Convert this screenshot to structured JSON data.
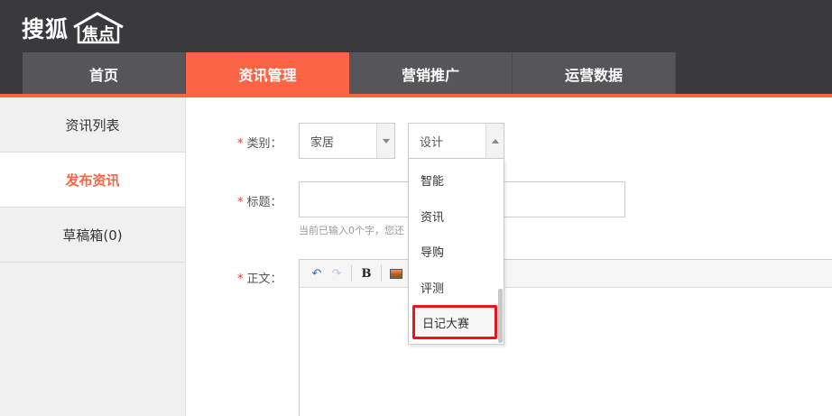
{
  "header": {
    "logo_text": "搜狐",
    "logo_house_text": "焦点"
  },
  "nav": {
    "tabs": [
      {
        "label": "首页",
        "active": false
      },
      {
        "label": "资讯管理",
        "active": true
      },
      {
        "label": "营销推广",
        "active": false
      },
      {
        "label": "运营数据",
        "active": false
      }
    ]
  },
  "sidebar": {
    "items": [
      {
        "label": "资讯列表",
        "active": false
      },
      {
        "label": "发布资讯",
        "active": true
      },
      {
        "label": "草稿箱(0)",
        "active": false
      }
    ]
  },
  "form": {
    "required_mark": "*",
    "category_label": "类别：",
    "category_select_1": "家居",
    "category_select_2": "设计",
    "title_label": "标题：",
    "title_hint": "当前已输入0个字，您还",
    "content_label": "正文："
  },
  "editor": {
    "toolbar": {
      "undo": "↶",
      "redo": "↷",
      "bold": "B"
    }
  },
  "dropdown": {
    "options": [
      "智能",
      "资讯",
      "导购",
      "评测",
      "日记大赛"
    ],
    "highlighted": "日记大赛",
    "scroll_position": 0.72
  },
  "colors": {
    "header_bg": "#3a3a3e",
    "accent": "#fc6446",
    "highlight_border": "#e8151b"
  }
}
